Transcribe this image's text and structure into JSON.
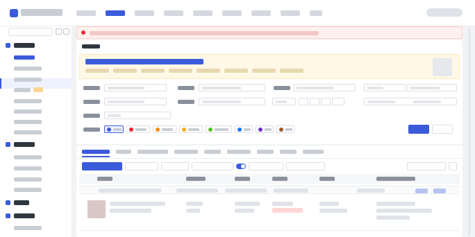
{
  "colors": {
    "accent": "#3b5bdb",
    "alert_background": "#fff1f0",
    "banner_background": "#fff8e6",
    "flag_colors": [
      "#3b5bdb",
      "#f5222d",
      "#fa8c16",
      "#faad14",
      "#52c41a",
      "#1677ff",
      "#722ed1",
      "#a05a2c"
    ]
  },
  "icons": [
    "logo-icon",
    "grid-icon",
    "chevron-down-icon",
    "search-icon",
    "filter-icon",
    "settings-icon"
  ]
}
